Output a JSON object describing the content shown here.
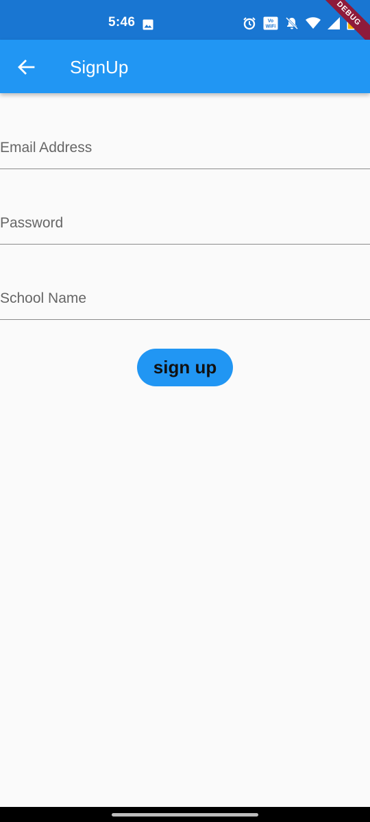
{
  "status_bar": {
    "time": "5:46",
    "icons": [
      "image-icon",
      "alarm-icon",
      "vowifi-icon",
      "notifications-off-icon",
      "wifi-icon",
      "signal-icon",
      "battery-icon"
    ],
    "vowifi_label": "Vo WiFi",
    "debug_label": "DEBUG"
  },
  "app_bar": {
    "title": "SignUp",
    "back_icon": "arrow-back-icon",
    "color": "#2196f3"
  },
  "form": {
    "email_placeholder": "Email Address",
    "password_placeholder": "Password",
    "school_placeholder": "School Name"
  },
  "button": {
    "label": "sign up",
    "color": "#2196f3"
  }
}
